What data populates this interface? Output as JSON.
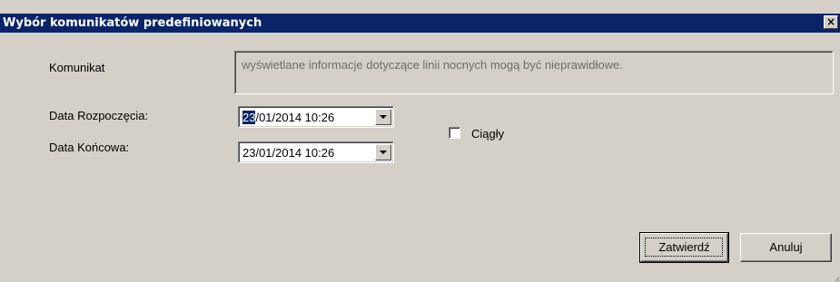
{
  "window": {
    "title": "Wybór komunikatów predefiniowanych",
    "close_glyph": "✕"
  },
  "form": {
    "message_label": "Komunikat",
    "message_text": "wyświetlane informacje dotyczące linii nocnych mogą być nieprawidłowe.",
    "start_label": "Data Rozpoczęcia:",
    "start_value_selected": "23",
    "start_value_rest": "/01/2014 10:26",
    "end_label": "Data Końcowa:",
    "end_value": "23/01/2014 10:26",
    "continuous_label": "Ciągły",
    "continuous_checked": false
  },
  "buttons": {
    "confirm": "Zatwierdź",
    "cancel": "Anuluj"
  }
}
